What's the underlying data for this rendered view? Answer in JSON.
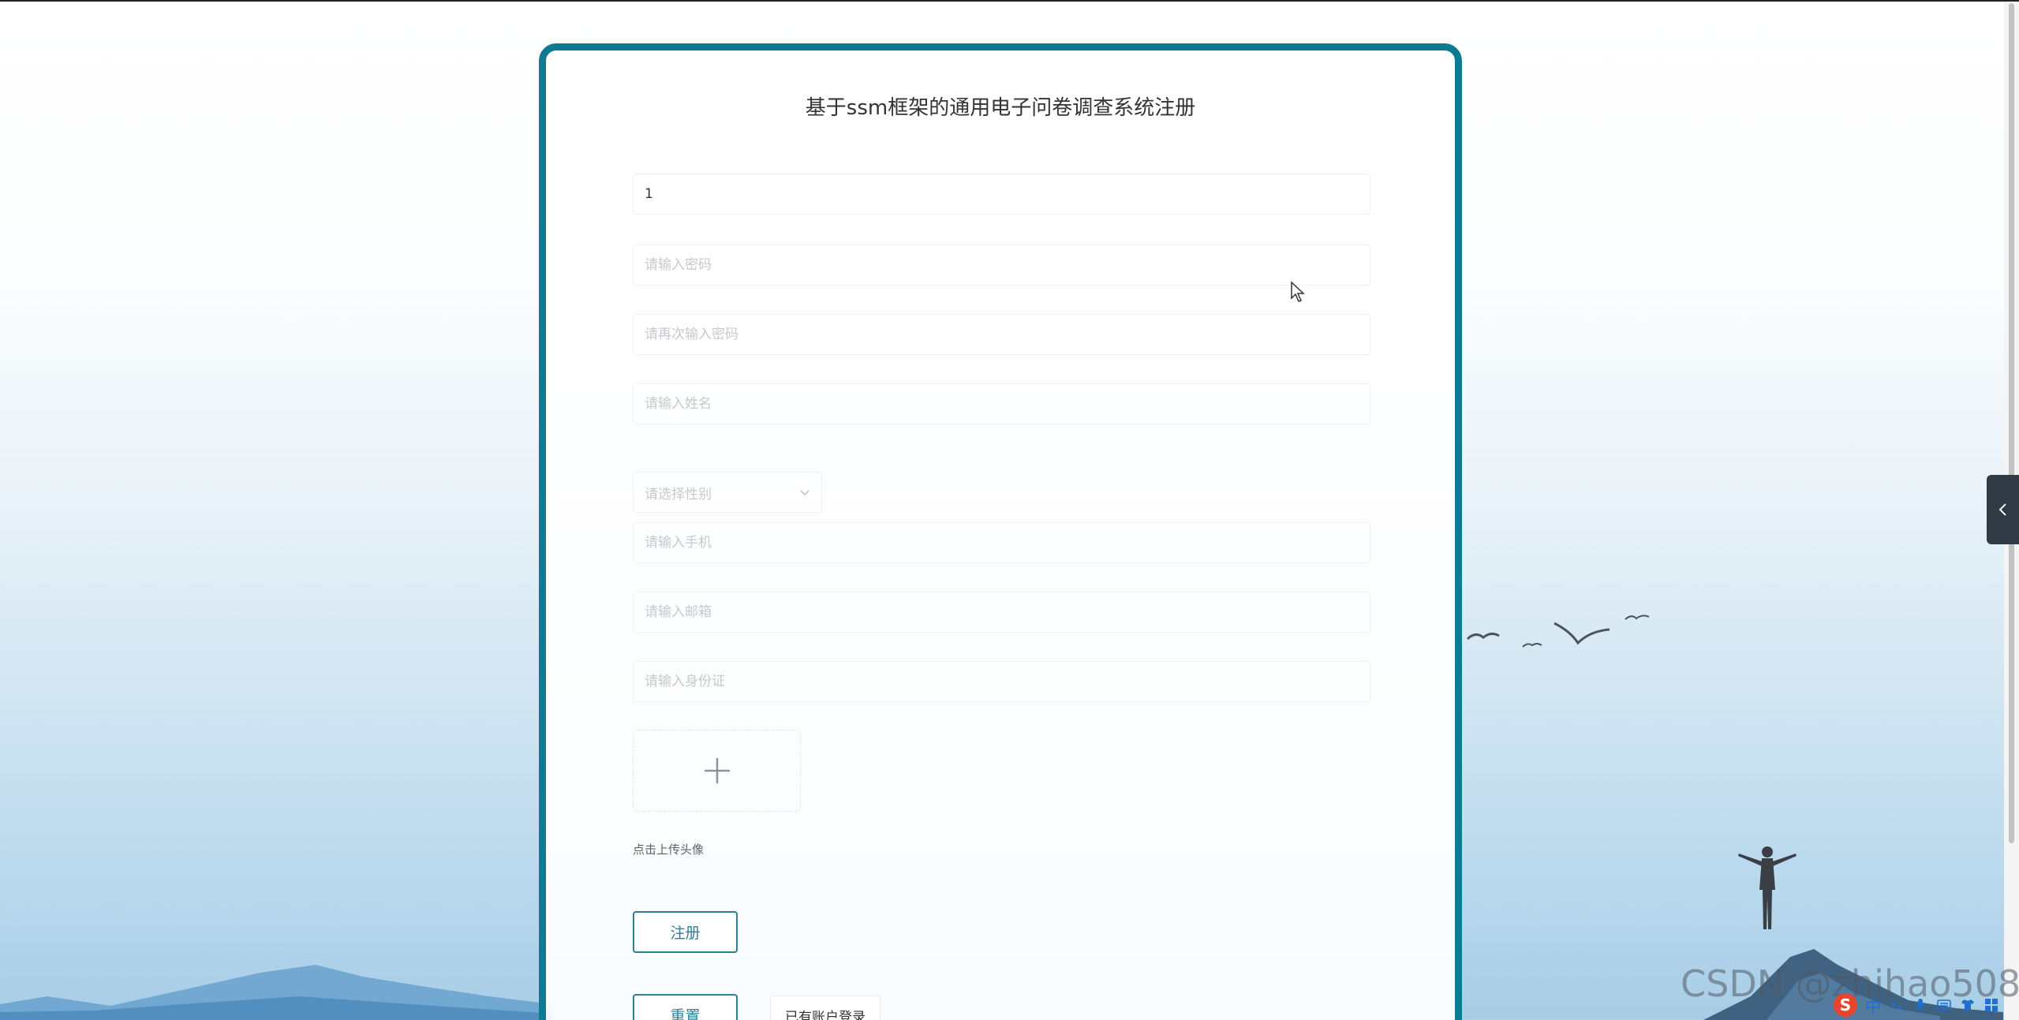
{
  "page": {
    "title": "基于ssm框架的通用电子问卷调查系统注册"
  },
  "form": {
    "account_value": "1",
    "password_placeholder": "请输入密码",
    "repassword_placeholder": "请再次输入密码",
    "name_placeholder": "请输入姓名",
    "gender_placeholder": "请选择性别",
    "phone_placeholder": "请输入手机",
    "email_placeholder": "请输入邮箱",
    "idcard_placeholder": "请输入身份证",
    "upload_hint": "点击上传头像"
  },
  "buttons": {
    "register": "注册",
    "reset": "重置",
    "login_link": "已有账户登录"
  },
  "overlay": {
    "watermark": "CSDN @zhihao508",
    "ime_logo": "S",
    "ime_mode": "中"
  },
  "colors": {
    "accent": "#0e7b93",
    "button": "#2d7f97"
  }
}
